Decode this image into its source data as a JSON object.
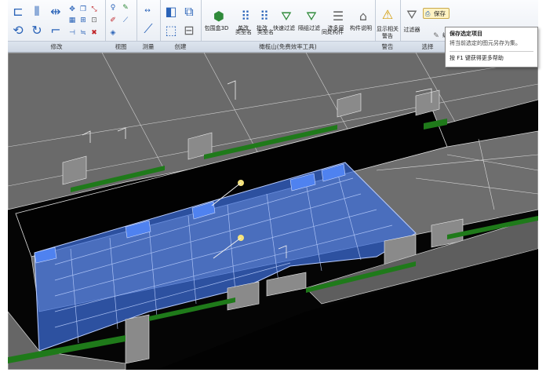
{
  "ribbon": {
    "panels": {
      "modify": "修改",
      "view": "视图",
      "measure": "测量",
      "create": "创建",
      "addin": "橄榄山(免费效率工具)",
      "warning": "警告",
      "select": "选择"
    },
    "addin_buttons": {
      "bbox3d": "包围盒3D",
      "single_type": "单改",
      "batch_type": "批改",
      "quick_filter": "快速过滤",
      "sub_filter": "隔组过滤",
      "multi_floor": "选多层",
      "component_desc": "构件说明"
    },
    "addin_sublabels": {
      "type_name_1": "类型名",
      "type_name_2": "类型名",
      "same_position": "同处构件"
    },
    "show_related_warning": "显示相关",
    "warning_label": "警告",
    "filter": "过滤器",
    "save": "保存",
    "edit": "编辑"
  },
  "tooltip": {
    "title": "保存选定项目",
    "description": "将当前选定的图元另存为集。",
    "help": "按 F1 键获得更多帮助"
  },
  "colors": {
    "ribbon_bg": "#eef2f7",
    "viewport_bg": "#050505",
    "selection_fill": "#3d6fdc",
    "wall_outline": "#e8e8e8",
    "floor_green": "#1f7a1a"
  },
  "icons": {
    "align": "align-icon",
    "offset": "offset-icon",
    "mirror": "mirror-icon",
    "move": "move-icon",
    "copy": "copy-icon",
    "rotate": "rotate-icon",
    "trim": "trim-icon",
    "split": "split-icon",
    "array": "array-icon",
    "scale": "scale-icon",
    "pin": "pin-icon",
    "delete": "delete-icon",
    "warning": "warning-icon",
    "filter": "filter-icon",
    "save": "save-icon"
  }
}
